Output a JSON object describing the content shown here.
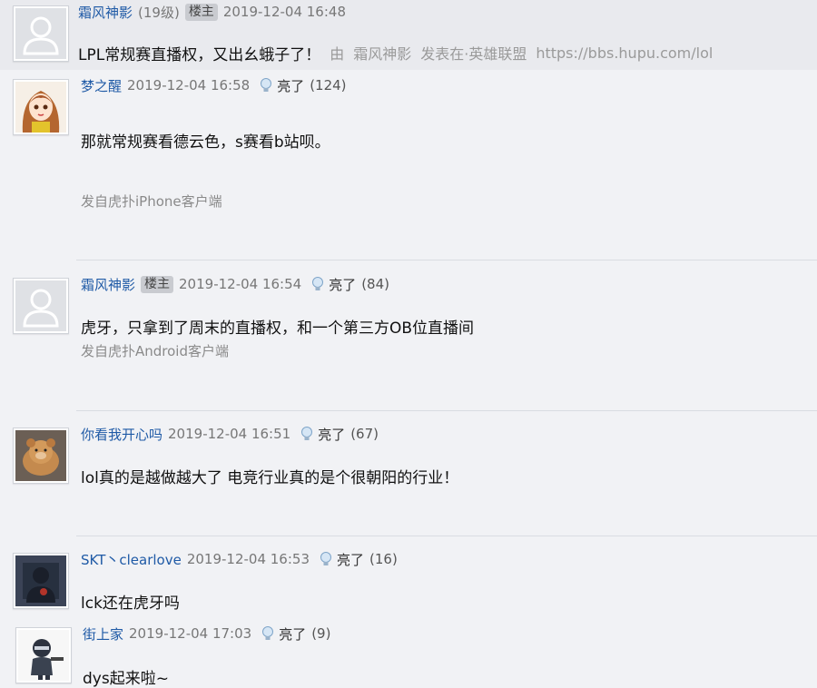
{
  "original_post": {
    "username": "霜风神影",
    "level": "(19级)",
    "op_badge": "楼主",
    "timestamp": "2019-12-04 16:48",
    "title": "LPL常规赛直播权，又出幺蛾子了！",
    "via_prefix": "由",
    "via_user": "霜风神影",
    "via_posted": "发表在·英雄联盟",
    "via_url": "https://bbs.hupu.com/lol"
  },
  "light_label": "亮了",
  "replies": [
    {
      "username": "梦之醒",
      "timestamp": "2019-12-04 16:58",
      "light_count": "(124)",
      "content": "那就常规赛看德云色，s赛看b站呗。",
      "source": "发自虎扑iPhone客户端"
    },
    {
      "username": "霜风神影",
      "op_badge": "楼主",
      "timestamp": "2019-12-04 16:54",
      "light_count": "(84)",
      "content": "虎牙，只拿到了周末的直播权，和一个第三方OB位直播间",
      "source": "发自虎扑Android客户端"
    },
    {
      "username": "你看我开心吗",
      "timestamp": "2019-12-04 16:51",
      "light_count": "(67)",
      "content": "lol真的是越做越大了 电竞行业真的是个很朝阳的行业！"
    },
    {
      "username": "SKT丶clearlove",
      "timestamp": "2019-12-04 16:53",
      "light_count": "(16)",
      "content": "lck还在虎牙吗"
    },
    {
      "username": "街上家",
      "timestamp": "2019-12-04 17:03",
      "light_count": "(9)",
      "content": "dys起来啦~"
    }
  ]
}
